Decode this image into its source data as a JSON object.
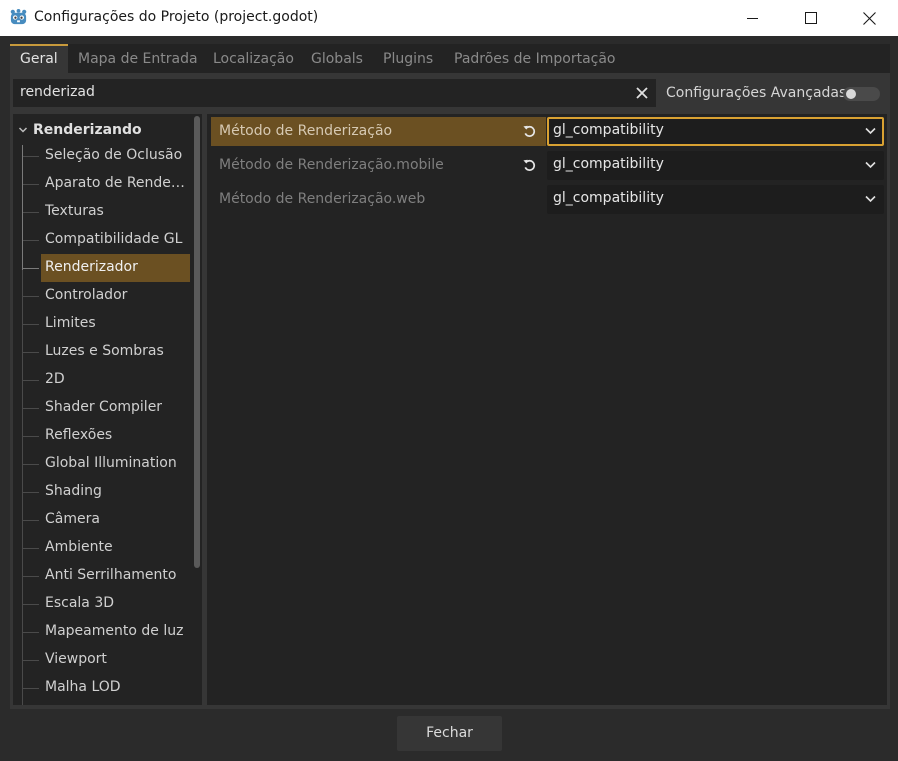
{
  "window": {
    "title": "Configurações do Projeto (project.godot)",
    "app_icon": "godot-icon",
    "controls": [
      "minimize-icon",
      "maximize-icon",
      "close-icon"
    ]
  },
  "tabs": [
    {
      "label": "Geral",
      "active": true
    },
    {
      "label": "Mapa de Entrada",
      "active": false
    },
    {
      "label": "Localização",
      "active": false
    },
    {
      "label": "Globals",
      "active": false
    },
    {
      "label": "Plugins",
      "active": false
    },
    {
      "label": "Padrões de Importação",
      "active": false
    }
  ],
  "search": {
    "value": "renderizad",
    "clear_icon": "clear-icon"
  },
  "advanced": {
    "label": "Configurações Avançadas",
    "enabled": false
  },
  "tree": {
    "root": "Renderizando",
    "items": [
      {
        "label": "Seleção de Oclusão"
      },
      {
        "label": "Aparato de Renderi..."
      },
      {
        "label": "Texturas"
      },
      {
        "label": "Compatibilidade GL"
      },
      {
        "label": "Renderizador",
        "selected": true
      },
      {
        "label": "Controlador"
      },
      {
        "label": "Limites"
      },
      {
        "label": "Luzes e Sombras"
      },
      {
        "label": "2D"
      },
      {
        "label": "Shader Compiler"
      },
      {
        "label": "Reflexões"
      },
      {
        "label": "Global Illumination"
      },
      {
        "label": "Shading"
      },
      {
        "label": "Câmera"
      },
      {
        "label": "Ambiente"
      },
      {
        "label": "Anti Serrilhamento"
      },
      {
        "label": "Escala 3D"
      },
      {
        "label": "Mapeamento de luz"
      },
      {
        "label": "Viewport"
      },
      {
        "label": "Malha LOD"
      }
    ]
  },
  "properties": [
    {
      "name": "Método de Renderização",
      "value": "gl_compatibility",
      "revertable": true,
      "focused": true
    },
    {
      "name": "Método de Renderização.mobile",
      "value": "gl_compatibility",
      "revertable": true,
      "focused": false
    },
    {
      "name": "Método de Renderização.web",
      "value": "gl_compatibility",
      "revertable": false,
      "focused": false
    }
  ],
  "footer": {
    "close_label": "Fechar"
  },
  "colors": {
    "accent": "#d9a132",
    "selection": "#6b5022",
    "panel": "#363636",
    "field": "#232323"
  }
}
